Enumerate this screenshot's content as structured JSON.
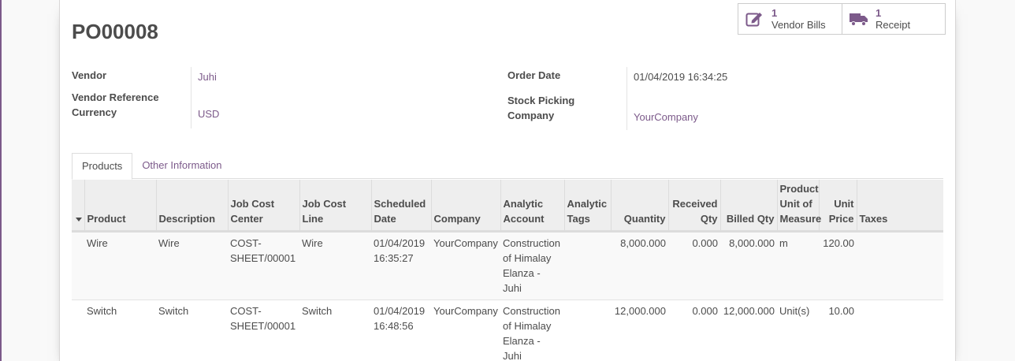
{
  "record": {
    "title": "PO00008"
  },
  "smart_buttons": [
    {
      "count": "1",
      "label": "Vendor Bills",
      "icon": "pencil-square-icon"
    },
    {
      "count": "1",
      "label": "Receipt",
      "icon": "truck-icon"
    }
  ],
  "fields": {
    "vendor_label": "Vendor",
    "vendor_value": "Juhi",
    "vendor_ref_label": "Vendor Reference",
    "currency_label": "Currency",
    "currency_value": "USD",
    "order_date_label": "Order Date",
    "order_date_value": "01/04/2019 16:34:25",
    "stock_picking_label": "Stock Picking",
    "company_label": "Company",
    "company_value": "YourCompany"
  },
  "tabs": [
    {
      "label": "Products",
      "active": true
    },
    {
      "label": "Other Information",
      "active": false
    }
  ],
  "table": {
    "headers": [
      "Product",
      "Description",
      "Job Cost Center",
      "Job Cost Line",
      "Scheduled Date",
      "Company",
      "Analytic Account",
      "Analytic Tags",
      "Quantity",
      "Received Qty",
      "Billed Qty",
      "Product Unit of Measure",
      "Unit Price",
      "Taxes"
    ],
    "rows": [
      {
        "product": "Wire",
        "description": "Wire",
        "job_cost_center": "COST-SHEET/00001",
        "job_cost_line": "Wire",
        "scheduled_date": "01/04/2019 16:35:27",
        "company": "YourCompany",
        "analytic_account": "Construction of Himalay Elanza - Juhi",
        "analytic_tags": "",
        "quantity": "8,000.000",
        "received_qty": "0.000",
        "billed_qty": "8,000.000",
        "uom": "m",
        "unit_price": "120.00",
        "taxes": ""
      },
      {
        "product": "Switch",
        "description": "Switch",
        "job_cost_center": "COST-SHEET/00001",
        "job_cost_line": "Switch",
        "scheduled_date": "01/04/2019 16:48:56",
        "company": "YourCompany",
        "analytic_account": "Construction of Himalay Elanza - Juhi",
        "analytic_tags": "",
        "quantity": "12,000.000",
        "received_qty": "0.000",
        "billed_qty": "12,000.000",
        "uom": "Unit(s)",
        "unit_price": "10.00",
        "taxes": ""
      }
    ]
  },
  "colors": {
    "accent": "#7c5a8a",
    "text": "#4c4c4c",
    "header_bg": "#eeeeee"
  }
}
